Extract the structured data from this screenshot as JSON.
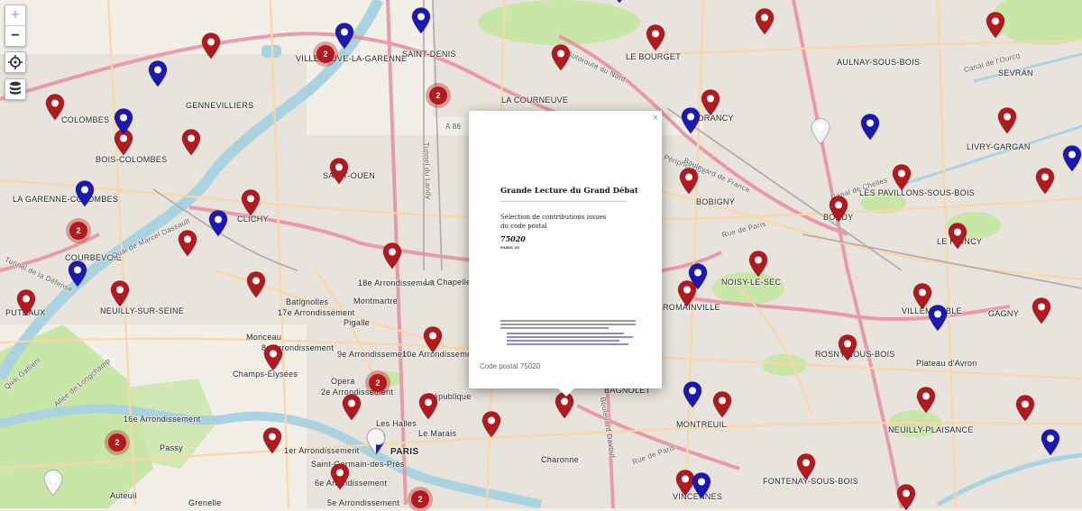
{
  "map": {
    "controls": {
      "zoom_in": "+",
      "zoom_out": "−"
    },
    "colors": {
      "red_marker": "#b3191e",
      "blue_marker": "#1c19b3",
      "water": "#aad3df",
      "park": "#c8e6a8",
      "road_major": "#e892a2",
      "road_secondary": "#fcd6a4"
    },
    "place_labels": [
      "VILLENEUVE-LA-GARENNE",
      "SAINT-DENIS",
      "LE BOURGET",
      "AULNAY-SOUS-BOIS",
      "SEVRAN",
      "GENNEVILLIERS",
      "COLOMBES",
      "LA COURNEUVE",
      "DRANCY",
      "LIVRY-GARGAN",
      "BOIS-COLOMBES",
      "SAINT-OUEN",
      "BOBIGNY",
      "LES PAVILLONS-SOUS-BOIS",
      "LA GARENNE-COLOMBES",
      "CLICHY",
      "BONDY",
      "LE RAINCY",
      "COURBEVOIE",
      "NOISY-LE-SEC",
      "ROMAINVILLE",
      "VILLEMOMBLE",
      "GAGNY",
      "PUTEAUX",
      "NEUILLY-SUR-SEINE",
      "ROSNY-SOUS-BOIS",
      "MONTREUIL",
      "NEUILLY-PLAISANCE",
      "PARIS",
      "BAGNOLET",
      "VINCENNES",
      "FONTENAY-SOUS-BOIS",
      "18e Arrondissement",
      "17e Arrondissement",
      "Batignolles",
      "Montmartre",
      "Pigalle",
      "La Chapelle",
      "Monceau",
      "8e Arrondissement",
      "9e Arrondissement",
      "10e Arrondissement",
      "Champs-Élysées",
      "Opera",
      "2e Arrondissement",
      "République",
      "16e Arrondissement",
      "Passy",
      "1er Arrondissement",
      "Les Halles",
      "Le Marais",
      "Saint-Germain-des-Prés",
      "6e Arrondissement",
      "5e Arrondissement",
      "Charonne",
      "Auteuil",
      "Grenelle",
      "Plateau d'Avron",
      "Boulevard Davout",
      "Rue de Paris",
      "Rue de Paris ",
      "Périphérique",
      "Allée de Longchamp",
      "Quai Gallieni",
      "Tunnel de la Défense",
      "Quai de Marcel Dassault",
      "Tunnel du Landy",
      "A 86",
      "L'Autoroute du Nord",
      "Canal de l'Ourcq",
      "Boulevard de France",
      "Canal de Chelles"
    ],
    "clusters": [
      "2",
      "2",
      "2",
      "2",
      "2",
      "2",
      "2"
    ]
  },
  "popup": {
    "title": "Grande Lecture du Grand Débat",
    "subtitle_line1": "Sélection de contributions issues",
    "subtitle_line2": "du code postal",
    "postal_code": "75020",
    "postal_sub": "PARIS 20",
    "caption": "Code postal 75020",
    "close_label": "×"
  }
}
